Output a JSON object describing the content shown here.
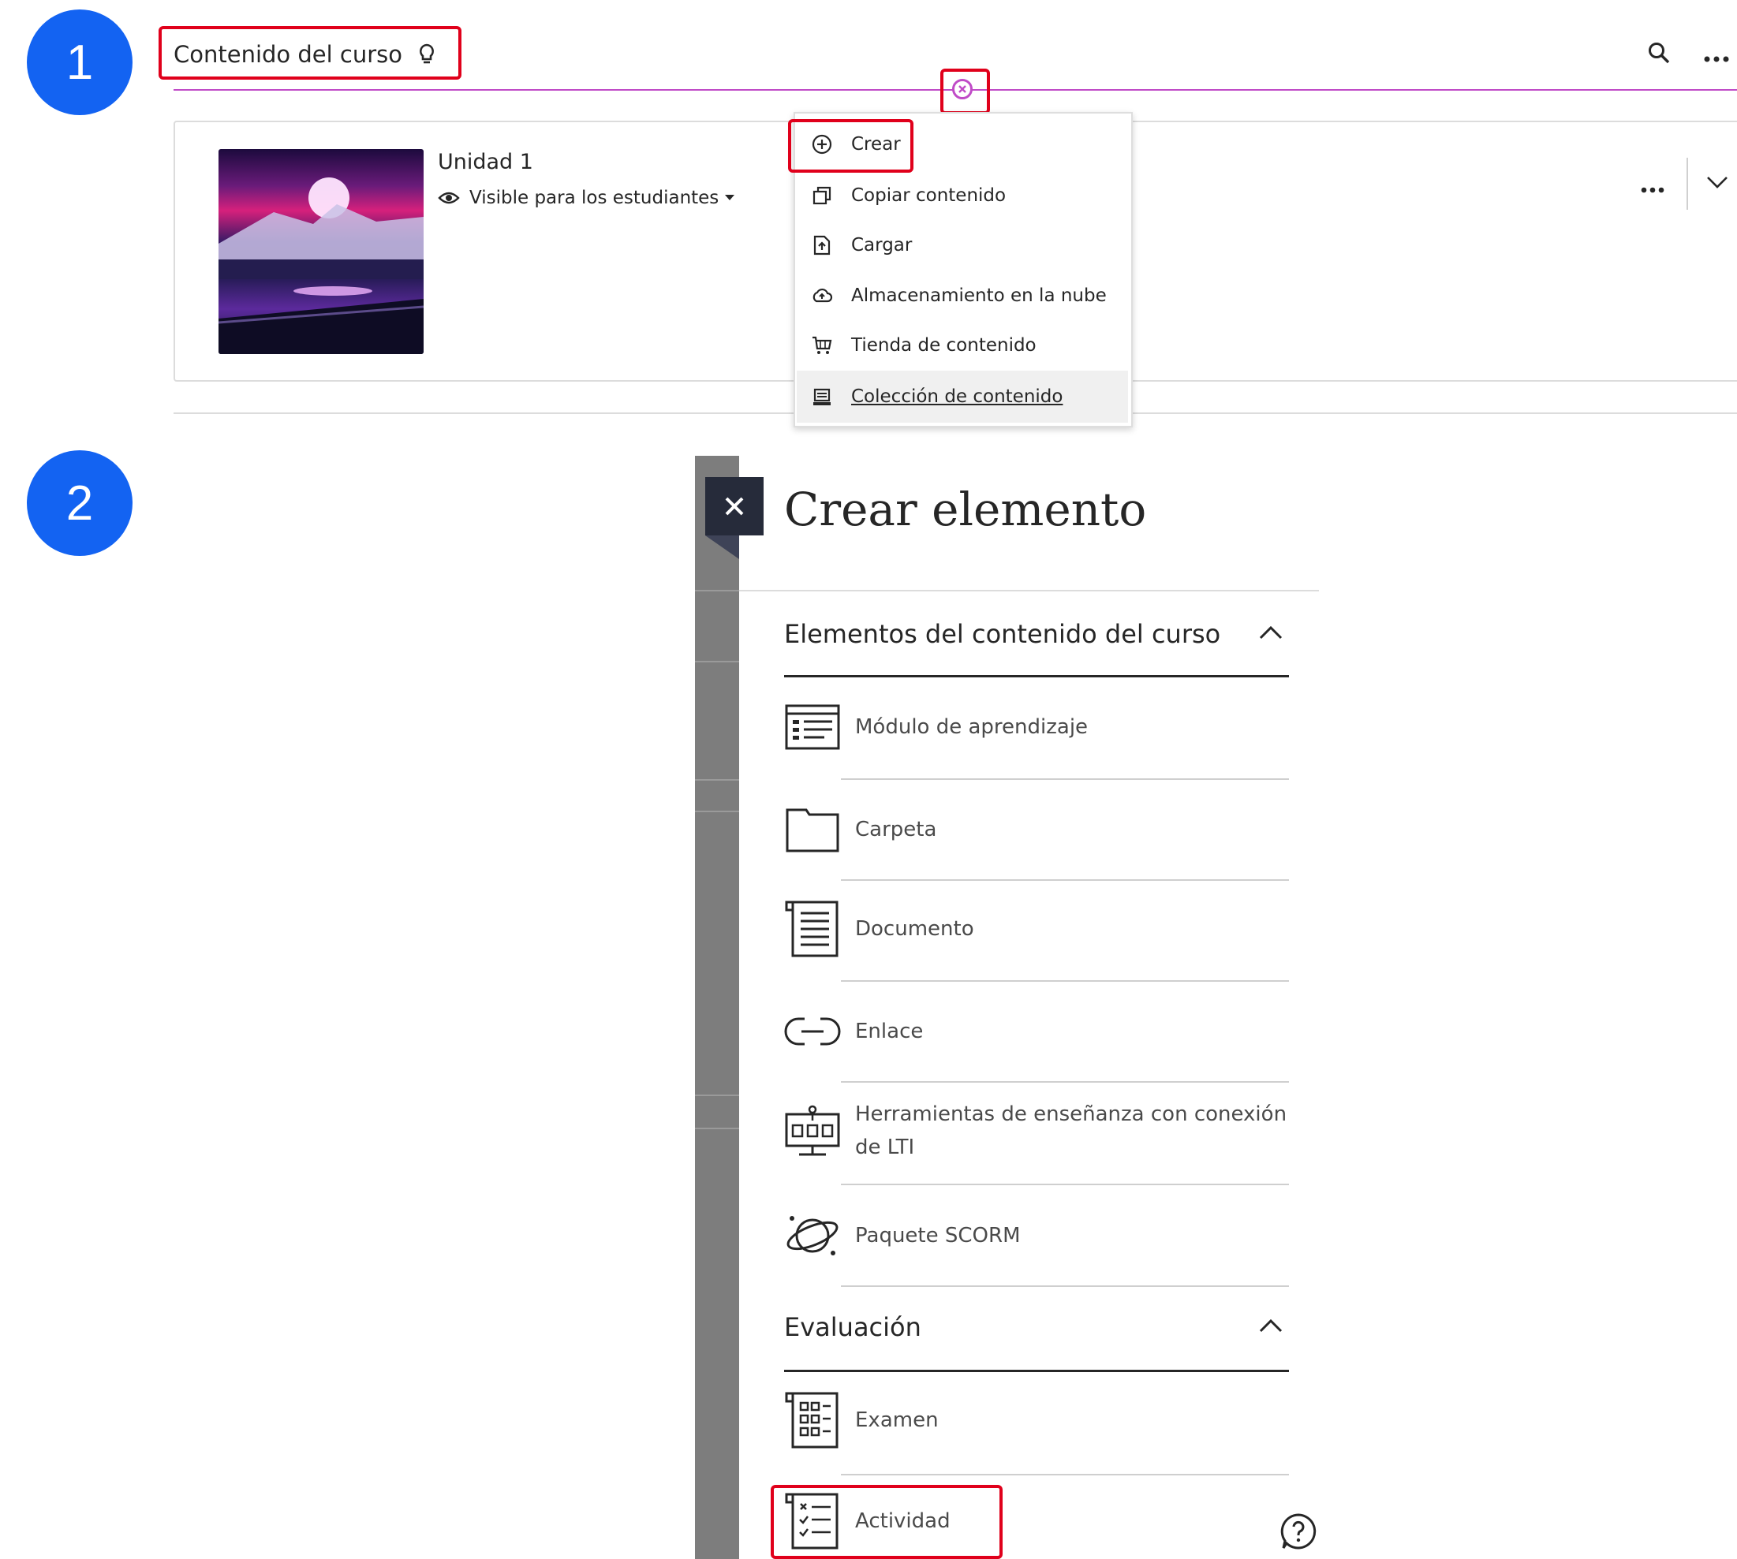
{
  "steps": [
    "1",
    "2"
  ],
  "header": {
    "title": "Contenido del curso",
    "icons": [
      "lightbulb-icon",
      "search-icon",
      "more-icon"
    ]
  },
  "unit": {
    "title": "Unidad 1",
    "visibility": "Visible para los estudiantes"
  },
  "add_menu": {
    "items": [
      {
        "label": "Crear",
        "icon": "plus-circle-icon"
      },
      {
        "label": "Copiar contenido",
        "icon": "copy-icon"
      },
      {
        "label": "Cargar",
        "icon": "upload-icon"
      },
      {
        "label": "Almacenamiento en la nube",
        "icon": "cloud-icon"
      },
      {
        "label": "Tienda de contenido",
        "icon": "cart-icon"
      },
      {
        "label": "Colección de contenido",
        "icon": "collection-icon"
      }
    ]
  },
  "panel": {
    "title": "Crear elemento",
    "section1": {
      "title": "Elementos del contenido del curso",
      "items": [
        {
          "label": "Módulo de aprendizaje",
          "icon": "learning-module-icon"
        },
        {
          "label": "Carpeta",
          "icon": "folder-icon"
        },
        {
          "label": "Documento",
          "icon": "document-icon"
        },
        {
          "label": "Enlace",
          "icon": "link-icon"
        },
        {
          "label_line1": "Herramientas de enseñanza con conexión",
          "label_line2": "de LTI",
          "icon": "lti-tools-icon"
        },
        {
          "label": "Paquete SCORM",
          "icon": "scorm-icon"
        }
      ]
    },
    "section2": {
      "title": "Evaluación",
      "items": [
        {
          "label": "Examen",
          "icon": "exam-icon"
        },
        {
          "label": "Actividad",
          "icon": "activity-icon"
        }
      ]
    }
  },
  "colors": {
    "step_badge": "#1363f2",
    "highlight": "#e0001b",
    "divider_accent": "#c04bc7",
    "panel_dark": "#262b3a"
  }
}
